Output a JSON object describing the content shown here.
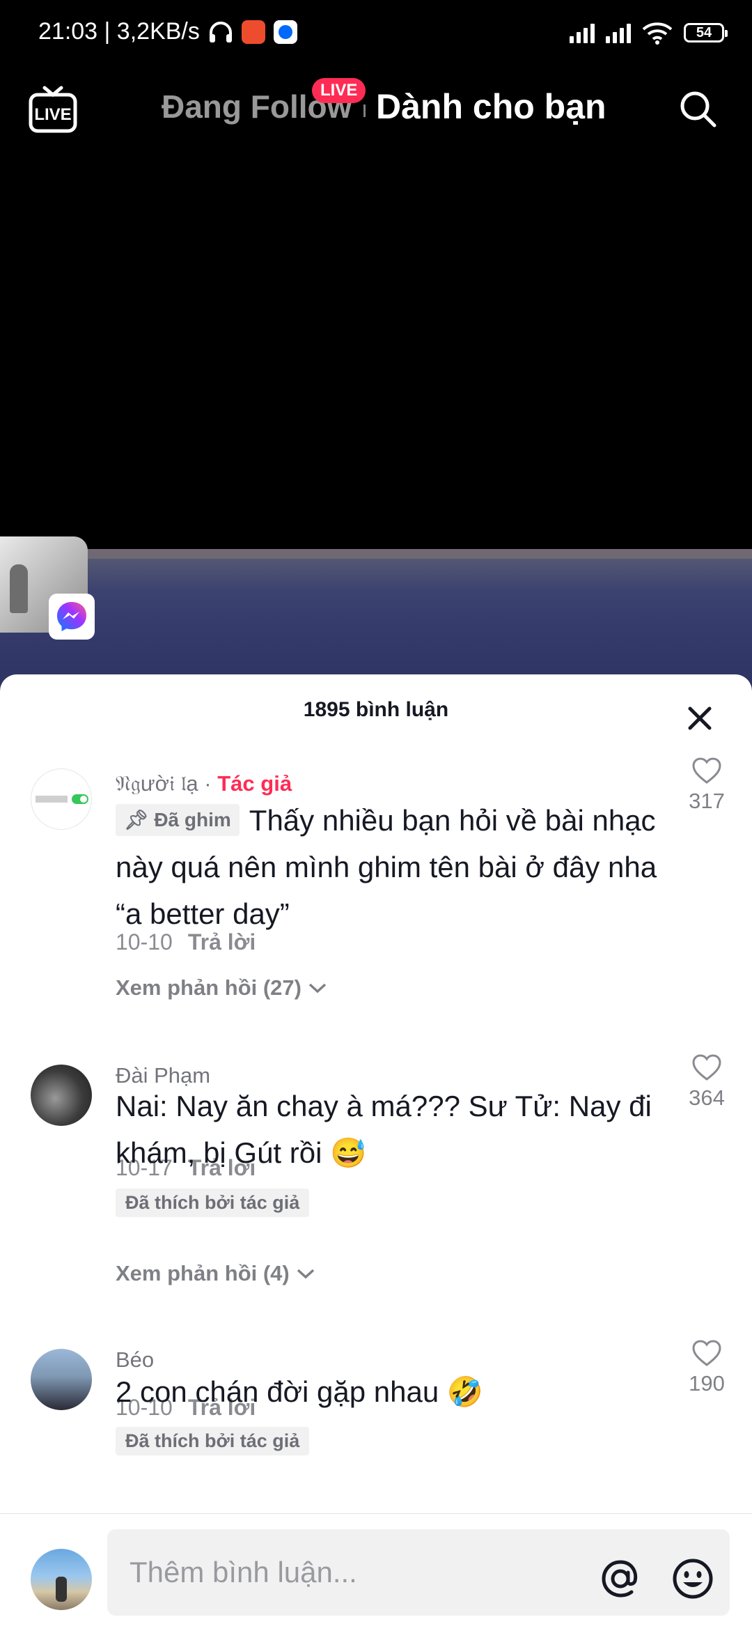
{
  "status_bar": {
    "time": "21:03 | 3,2KB/s",
    "battery": "54",
    "app_icons": [
      "headphones-icon",
      "shopee-icon",
      "zalo-icon"
    ]
  },
  "top_nav": {
    "live_label": "LIVE",
    "following_tab": "Đang Follow",
    "live_badge": "LIVE",
    "for_you_tab": "Dành cho bạn"
  },
  "comments_sheet": {
    "title": "1895 bình luận",
    "comments": [
      {
        "username": "𝔑𝔤ườ𝔦 𝔩ạ",
        "separator": "·",
        "author_tag": "Tác giả",
        "pinned_label": "Đã ghim",
        "text": "Thấy nhiều bạn hỏi về bài nhạc này quá nên mình ghim tên bài ở đây nha “a better day”",
        "date": "10-10",
        "reply_label": "Trả lời",
        "likes": "317",
        "view_replies": "Xem phản hồi (27)"
      },
      {
        "username": "Đài Phạm",
        "text": "Nai: Nay ăn chay à má??? Sư Tử: Nay đi khám, bị Gút rồi 😅",
        "date": "10-17",
        "reply_label": "Trả lời",
        "liked_by_author": "Đã thích bởi tác giả",
        "likes": "364",
        "view_replies": "Xem phản hồi (4)"
      },
      {
        "username": "Béo",
        "text": "2 con chán đời gặp nhau 🤣",
        "date": "10-10",
        "reply_label": "Trả lời",
        "liked_by_author": "Đã thích bởi tác giả",
        "likes": "190"
      }
    ]
  },
  "input_bar": {
    "placeholder": "Thêm bình luận..."
  },
  "colors": {
    "accent": "#fe2c55",
    "sheet_bg": "#ffffff",
    "tag_bg": "#f1f1f2"
  }
}
